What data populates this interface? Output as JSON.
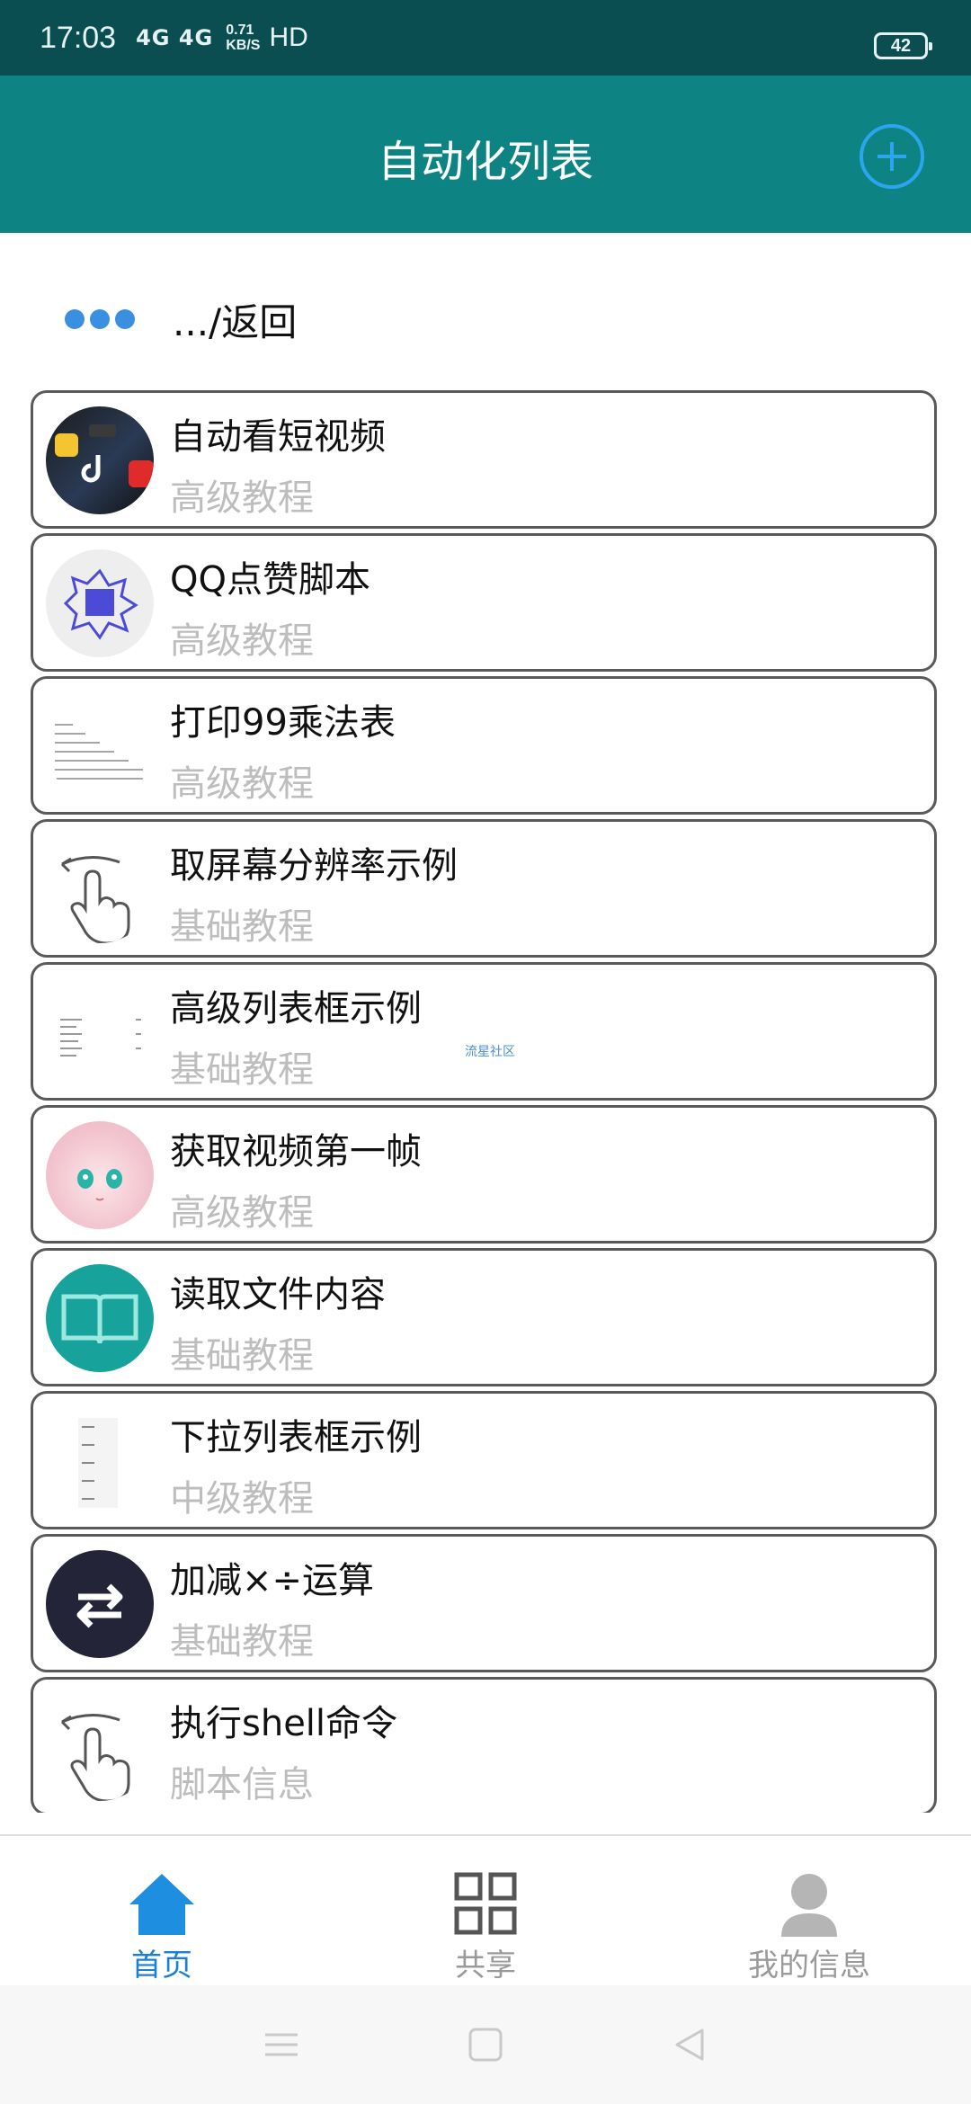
{
  "status_bar": {
    "time": "17:03",
    "network": "4G 4G",
    "speed_value": "0.71",
    "speed_unit": "KB/S",
    "hd": "HD",
    "battery": "42"
  },
  "app_bar": {
    "title": "自动化列表",
    "add_icon": "plus-circle-icon"
  },
  "back_row": {
    "label": ".../返回"
  },
  "list": {
    "items": [
      {
        "title": "自动看短视频",
        "subtitle": "高级教程",
        "icon": "video-apps-thumbnail"
      },
      {
        "title": "QQ点赞脚本",
        "subtitle": "高级教程",
        "icon": "like-stamp-thumbnail"
      },
      {
        "title": "打印99乘法表",
        "subtitle": "高级教程",
        "icon": "multiplication-table-thumbnail"
      },
      {
        "title": "取屏幕分辨率示例",
        "subtitle": "基础教程",
        "icon": "swipe-hand-icon"
      },
      {
        "title": "高级列表框示例",
        "subtitle": "基础教程",
        "icon": "list-preview-thumbnail",
        "overlay": "流星社区"
      },
      {
        "title": "获取视频第一帧",
        "subtitle": "高级教程",
        "icon": "anime-girl-thumbnail"
      },
      {
        "title": "读取文件内容",
        "subtitle": "基础教程",
        "icon": "book-icon"
      },
      {
        "title": "下拉列表框示例",
        "subtitle": "中级教程",
        "icon": "dropdown-list-thumbnail"
      },
      {
        "title": "加减×÷运算",
        "subtitle": "基础教程",
        "icon": "swap-arrows-icon"
      },
      {
        "title": "执行shell命令",
        "subtitle": "脚本信息",
        "icon": "swipe-hand-icon"
      }
    ]
  },
  "bottom_nav": {
    "home": "首页",
    "share": "共享",
    "profile": "我的信息"
  },
  "colors": {
    "status_bar": "#0b4e52",
    "app_bar": "#0e8383",
    "accent": "#1b7fd4",
    "add_button": "#2aa6ef"
  }
}
